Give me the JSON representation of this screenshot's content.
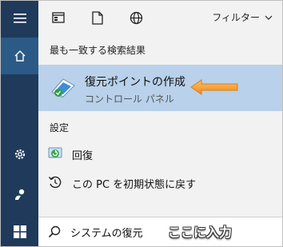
{
  "toolbar": {
    "filter_label": "フィルター"
  },
  "content": {
    "best_match_heading": "最も一致する検索結果",
    "best_match": {
      "title": "復元ポイントの作成",
      "subtitle": "コントロール パネル"
    },
    "settings_heading": "設定",
    "settings_items": [
      {
        "label": "回復",
        "icon": "recovery-icon"
      },
      {
        "label": "この PC を初期状態に戻す",
        "icon": "reset-pc-icon"
      }
    ]
  },
  "search": {
    "value": "システムの復元",
    "hint": "ここに入力"
  },
  "colors": {
    "rail": "#1f3a5a",
    "rail_active": "#2b5a86",
    "highlight": "#b9d1ea",
    "arrow": "#f39a2f"
  }
}
